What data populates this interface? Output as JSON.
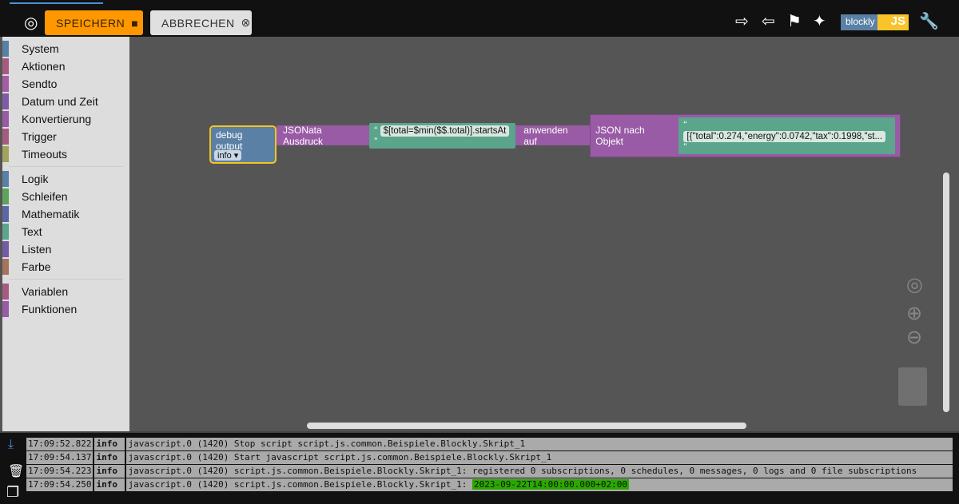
{
  "toolbar": {
    "save_label": "SPEICHERN",
    "cancel_label": "ABBRECHEN",
    "brand_left": "blockly",
    "brand_right": "JS"
  },
  "sidebar": {
    "groups": [
      [
        {
          "label": "System",
          "color": "#5b80a5"
        },
        {
          "label": "Aktionen",
          "color": "#a55b80"
        },
        {
          "label": "Sendto",
          "color": "#a55ba5"
        },
        {
          "label": "Datum und Zeit",
          "color": "#805ba5"
        },
        {
          "label": "Konvertierung",
          "color": "#995ba5"
        },
        {
          "label": "Trigger",
          "color": "#a55b80"
        },
        {
          "label": "Timeouts",
          "color": "#9fa55b"
        }
      ],
      [
        {
          "label": "Logik",
          "color": "#5b80a5"
        },
        {
          "label": "Schleifen",
          "color": "#5ba55b"
        },
        {
          "label": "Mathematik",
          "color": "#5b67a5"
        },
        {
          "label": "Text",
          "color": "#5ba58c"
        },
        {
          "label": "Listen",
          "color": "#745ba5"
        },
        {
          "label": "Farbe",
          "color": "#a5745b"
        }
      ],
      [
        {
          "label": "Variablen",
          "color": "#a55b80"
        },
        {
          "label": "Funktionen",
          "color": "#995ba5"
        }
      ]
    ]
  },
  "blocks": {
    "debug_label": "debug output",
    "debug_level": "info",
    "jsonata_label": "JSONata Ausdruck",
    "expression": "$[total=$min($$.total)].startsAt",
    "apply_label": "anwenden auf",
    "json_label": "JSON nach Objekt",
    "json_text": "[{\"total\":0.274,\"energy\":0.0742,\"tax\":0.1998,\"st..."
  },
  "log": {
    "rows": [
      {
        "time": "17:09:52.822",
        "level": "info",
        "msg": "javascript.0 (1420) Stop script script.js.common.Beispiele.Blockly.Skript_1",
        "hl": ""
      },
      {
        "time": "17:09:54.137",
        "level": "info",
        "msg": "javascript.0 (1420) Start javascript script.js.common.Beispiele.Blockly.Skript_1",
        "hl": ""
      },
      {
        "time": "17:09:54.223",
        "level": "info",
        "msg": "javascript.0 (1420) script.js.common.Beispiele.Blockly.Skript_1: registered 0 subscriptions, 0 schedules, 0 messages, 0 logs and 0 file subscriptions",
        "hl": ""
      },
      {
        "time": "17:09:54.250",
        "level": "info",
        "msg": "javascript.0 (1420) script.js.common.Beispiele.Blockly.Skript_1: ",
        "hl": "2023-09-22T14:00:00.000+02:00"
      }
    ]
  }
}
